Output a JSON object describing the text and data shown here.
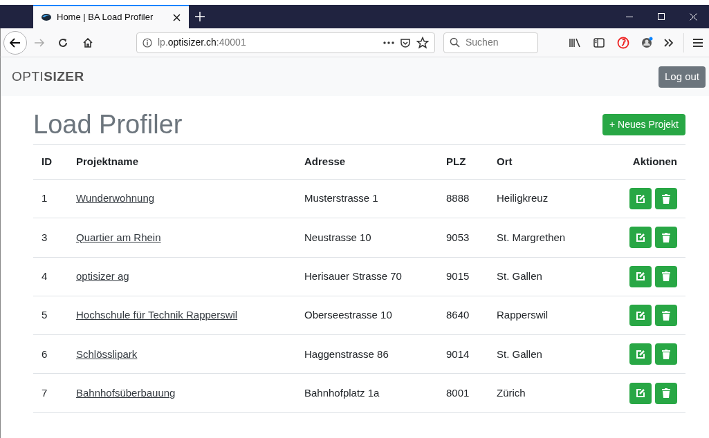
{
  "browser": {
    "tab_title": "Home | BA Load Profiler",
    "url": {
      "prefix": "lp.",
      "domain": "optisizer.ch",
      "suffix": ":40001"
    },
    "search_placeholder": "Suchen"
  },
  "navbar": {
    "logo_light": "OPTI",
    "logo_bold": "SIZER",
    "logout": "Log out"
  },
  "page": {
    "title": "Load Profiler",
    "new_project": "+ Neues Projekt"
  },
  "table": {
    "columns": [
      "ID",
      "Projektname",
      "Adresse",
      "PLZ",
      "Ort",
      "Aktionen"
    ],
    "rows": [
      {
        "id": "1",
        "name": "Wunderwohnung",
        "address": "Musterstrasse 1",
        "plz": "8888",
        "city": "Heiligkreuz"
      },
      {
        "id": "3",
        "name": "Quartier am Rhein",
        "address": "Neustrasse 10",
        "plz": "9053",
        "city": "St. Margrethen"
      },
      {
        "id": "4",
        "name": "optisizer ag",
        "address": "Herisauer Strasse 70",
        "plz": "9015",
        "city": "St. Gallen"
      },
      {
        "id": "5",
        "name": "Hochschule für Technik Rapperswil",
        "address": "Oberseestrasse 10",
        "plz": "8640",
        "city": "Rapperswil"
      },
      {
        "id": "6",
        "name": "Schlösslipark",
        "address": "Haggenstrasse 86",
        "plz": "9014",
        "city": "St. Gallen"
      },
      {
        "id": "7",
        "name": "Bahnhofsüberbauung",
        "address": "Bahnhofplatz 1a",
        "plz": "8001",
        "city": "Zürich"
      }
    ]
  }
}
